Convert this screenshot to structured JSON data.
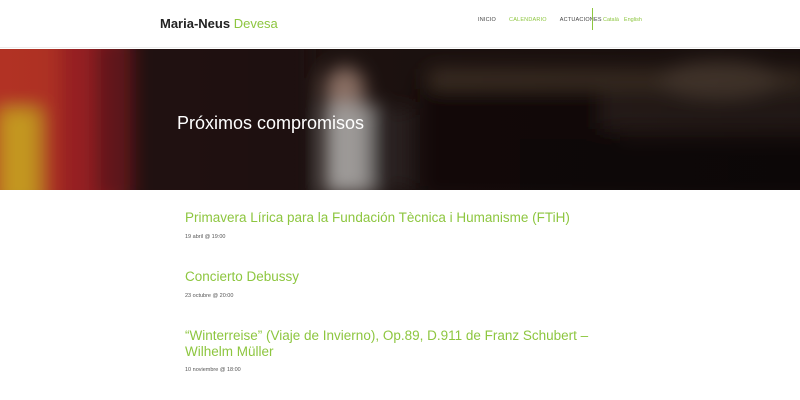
{
  "header": {
    "logo_first": "Maria-Neus",
    "logo_last": "Devesa",
    "nav": [
      "INICIO",
      "CALENDARIO",
      "ACTUACIONES"
    ],
    "active_nav": "CALENDARIO",
    "languages": [
      "Català",
      "English"
    ]
  },
  "hero": {
    "title": "Próximos compromisos"
  },
  "events": [
    {
      "title": "Primavera Lírica para la Fundación Tècnica i Humanisme (FTiH)",
      "date": "19 abril @ 19:00"
    },
    {
      "title": "Concierto Debussy",
      "date": "23 octubre @ 20:00"
    },
    {
      "title": "“Winterreise” (Viaje de Invierno), Op.89, D.911 de Franz Schubert – Wilhelm Müller",
      "date": "10 noviembre @ 18:00"
    }
  ],
  "colors": {
    "accent": "#8dc63f",
    "text": "#333333",
    "hero_overlay": "#1e1414"
  }
}
